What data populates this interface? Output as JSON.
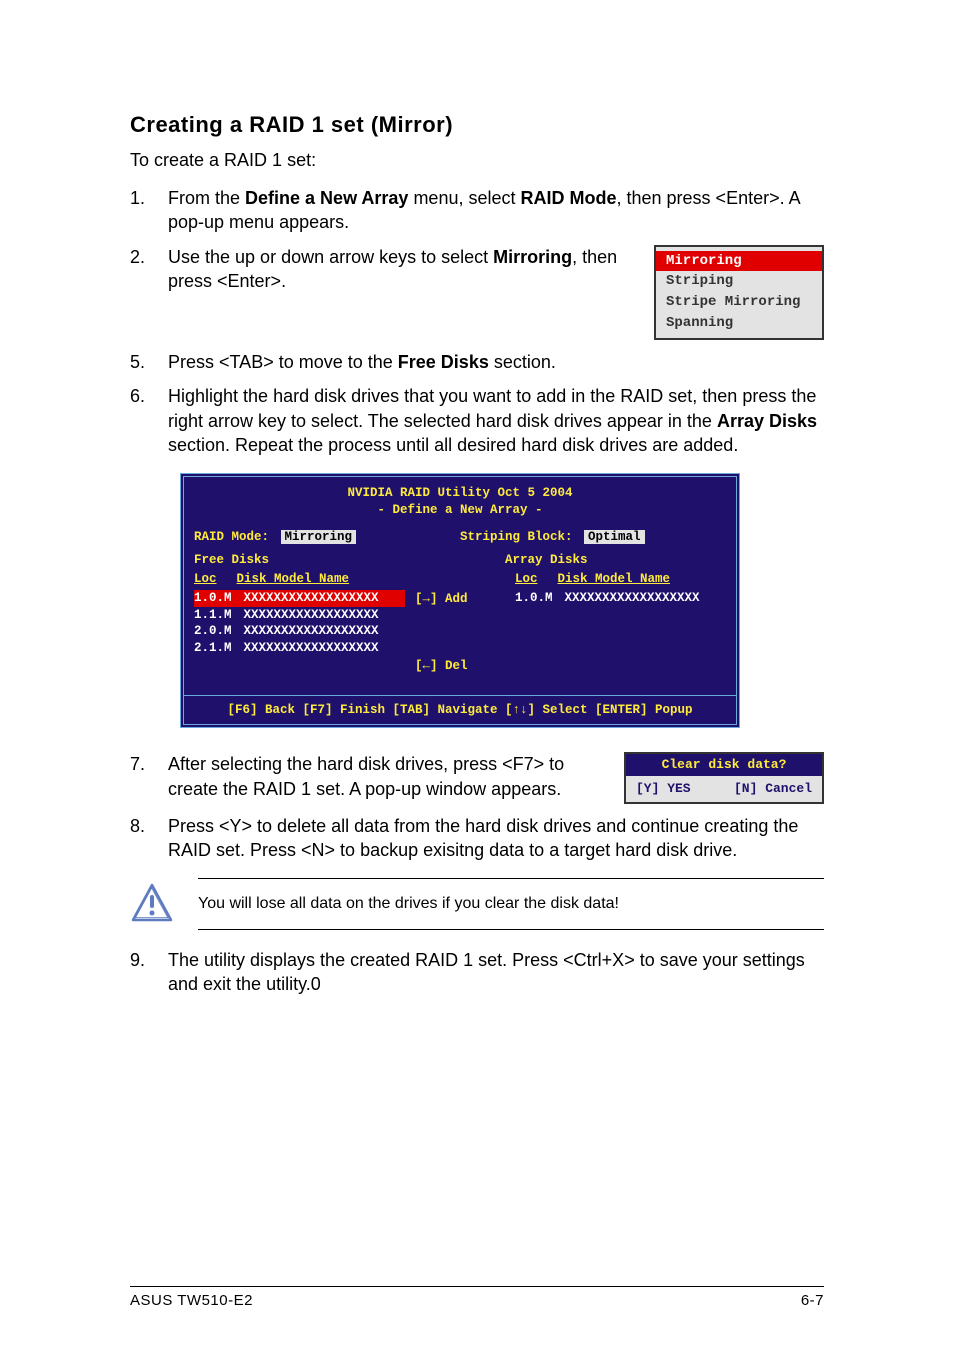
{
  "heading": "Creating a RAID 1 set (Mirror)",
  "intro": "To create a RAID 1 set:",
  "steps": {
    "s1": {
      "num": "1.",
      "t1": "From the ",
      "b1": "Define a New Array",
      "t2": " menu, select ",
      "b2": "RAID Mode",
      "t3": ", then press <Enter>. A pop-up menu appears."
    },
    "s2": {
      "num": "2.",
      "t1": "Use the up or down arrow keys to select ",
      "b1": "Mirroring",
      "t2": ", then press <Enter>."
    },
    "s5": {
      "num": "5.",
      "t1": "Press <TAB> to move to the ",
      "b1": "Free Disks",
      "t2": " section."
    },
    "s6": {
      "num": "6.",
      "t1": "Highlight the hard disk drives that you want to add in the RAID set, then press the right arrow key to select. The selected hard disk drives appear in the ",
      "b1": "Array Disks",
      "t2": " section. Repeat the process until all desired hard disk drives are added."
    },
    "s7": {
      "num": "7.",
      "t1": "After selecting the hard disk drives, press <F7> to create the RAID 1 set. A pop-up window appears."
    },
    "s8": {
      "num": "8.",
      "t1": "Press <Y> to delete all data from the hard disk drives and continue creating the RAID set. Press <N> to backup exisitng data to a target hard disk drive."
    },
    "s9": {
      "num": "9.",
      "t1": "The utility displays the created RAID 1 set. Press <Ctrl+X> to save your settings and exit the utility.0"
    }
  },
  "popup_mode": {
    "options": [
      "Mirroring",
      "Striping",
      "Stripe Mirroring",
      "Spanning"
    ]
  },
  "bios": {
    "title1": "NVIDIA RAID Utility  Oct 5 2004",
    "title2": "- Define a New Array -",
    "raid_mode_label": "RAID Mode:",
    "raid_mode_value": "Mirroring",
    "stripe_label": "Striping Block:",
    "stripe_value": "Optimal",
    "free_label": "Free Disks",
    "array_label": "Array Disks",
    "col_loc": "Loc",
    "col_model": "Disk Model Name",
    "free_disks": [
      {
        "loc": "1.0.M",
        "model": "XXXXXXXXXXXXXXXXXX"
      },
      {
        "loc": "1.1.M",
        "model": "XXXXXXXXXXXXXXXXXX"
      },
      {
        "loc": "2.0.M",
        "model": "XXXXXXXXXXXXXXXXXX"
      },
      {
        "loc": "2.1.M",
        "model": "XXXXXXXXXXXXXXXXXX"
      }
    ],
    "array_disks": [
      {
        "loc": "1.0.M",
        "model": "XXXXXXXXXXXXXXXXXX"
      }
    ],
    "add": "[→] Add",
    "del": "[←] Del",
    "footer": "[F6] Back  [F7] Finish  [TAB] Navigate  [↑↓] Select  [ENTER] Popup"
  },
  "popup_clear": {
    "title": "Clear disk data?",
    "yes": "[Y] YES",
    "no": "[N] Cancel"
  },
  "note": "You will lose all data on the drives if you clear the disk data!",
  "footer_left": "ASUS TW510-E2",
  "footer_right": "6-7"
}
